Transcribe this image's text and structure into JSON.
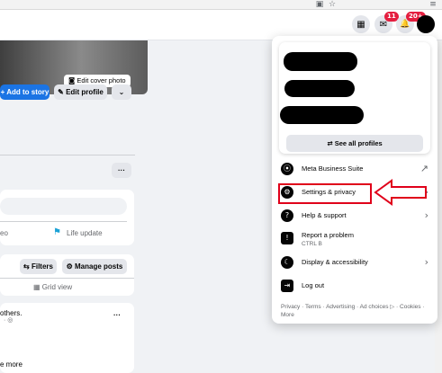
{
  "browser": {
    "icons": [
      "screenshot-icon",
      "star-icon",
      "menu-icon"
    ],
    "glyphs": [
      "▣",
      "☆",
      "≡"
    ]
  },
  "topbar": {
    "grid_glyph": "▦",
    "messenger_glyph": "✉",
    "messenger_badge": "11",
    "notifications_glyph": "🔔",
    "notifications_badge": "20+"
  },
  "profile": {
    "edit_cover_label": "Edit cover photo",
    "edit_cover_glyph": "◙",
    "add_story_label": "+ Add to story",
    "edit_profile_label": "✎ Edit profile",
    "expand_glyph": "⌄",
    "more_glyph": "···"
  },
  "composer": {
    "left_fragment": "eo",
    "life_update_label": "Life update"
  },
  "posts": {
    "filters_label": "⇆ Filters",
    "manage_posts_label": "⚙ Manage posts",
    "grid_view_label": "▦ Grid view"
  },
  "post": {
    "text_fragment": "others.",
    "sub_fragment": "· ◎",
    "see_more_fragment": "e more",
    "options_glyph": "···"
  },
  "account_menu": {
    "see_all_profiles_label": "See all profiles",
    "see_all_glyph": "⇄",
    "items": [
      {
        "label": "Meta Business Suite",
        "icon": "meta-business-suite-icon",
        "glyph": "⦿",
        "trail": "↗"
      },
      {
        "label": "Settings & privacy",
        "icon": "gear-icon",
        "glyph": "⚙",
        "trail": "›"
      },
      {
        "label": "Help & support",
        "icon": "help-icon",
        "glyph": "?",
        "trail": "›"
      },
      {
        "label": "Report a problem",
        "sublabel": "CTRL B",
        "icon": "report-icon",
        "glyph": "!",
        "trail": ""
      },
      {
        "label": "Display & accessibility",
        "icon": "moon-icon",
        "glyph": "☾",
        "trail": "›"
      },
      {
        "label": "Log out",
        "icon": "logout-icon",
        "glyph": "⇥",
        "trail": ""
      }
    ],
    "footer": "Privacy · Terms · Advertising · Ad choices ▷ · Cookies · More"
  },
  "colors": {
    "accent": "#1b74e4",
    "highlight": "#e0001a",
    "badge": "#e41e3f"
  }
}
